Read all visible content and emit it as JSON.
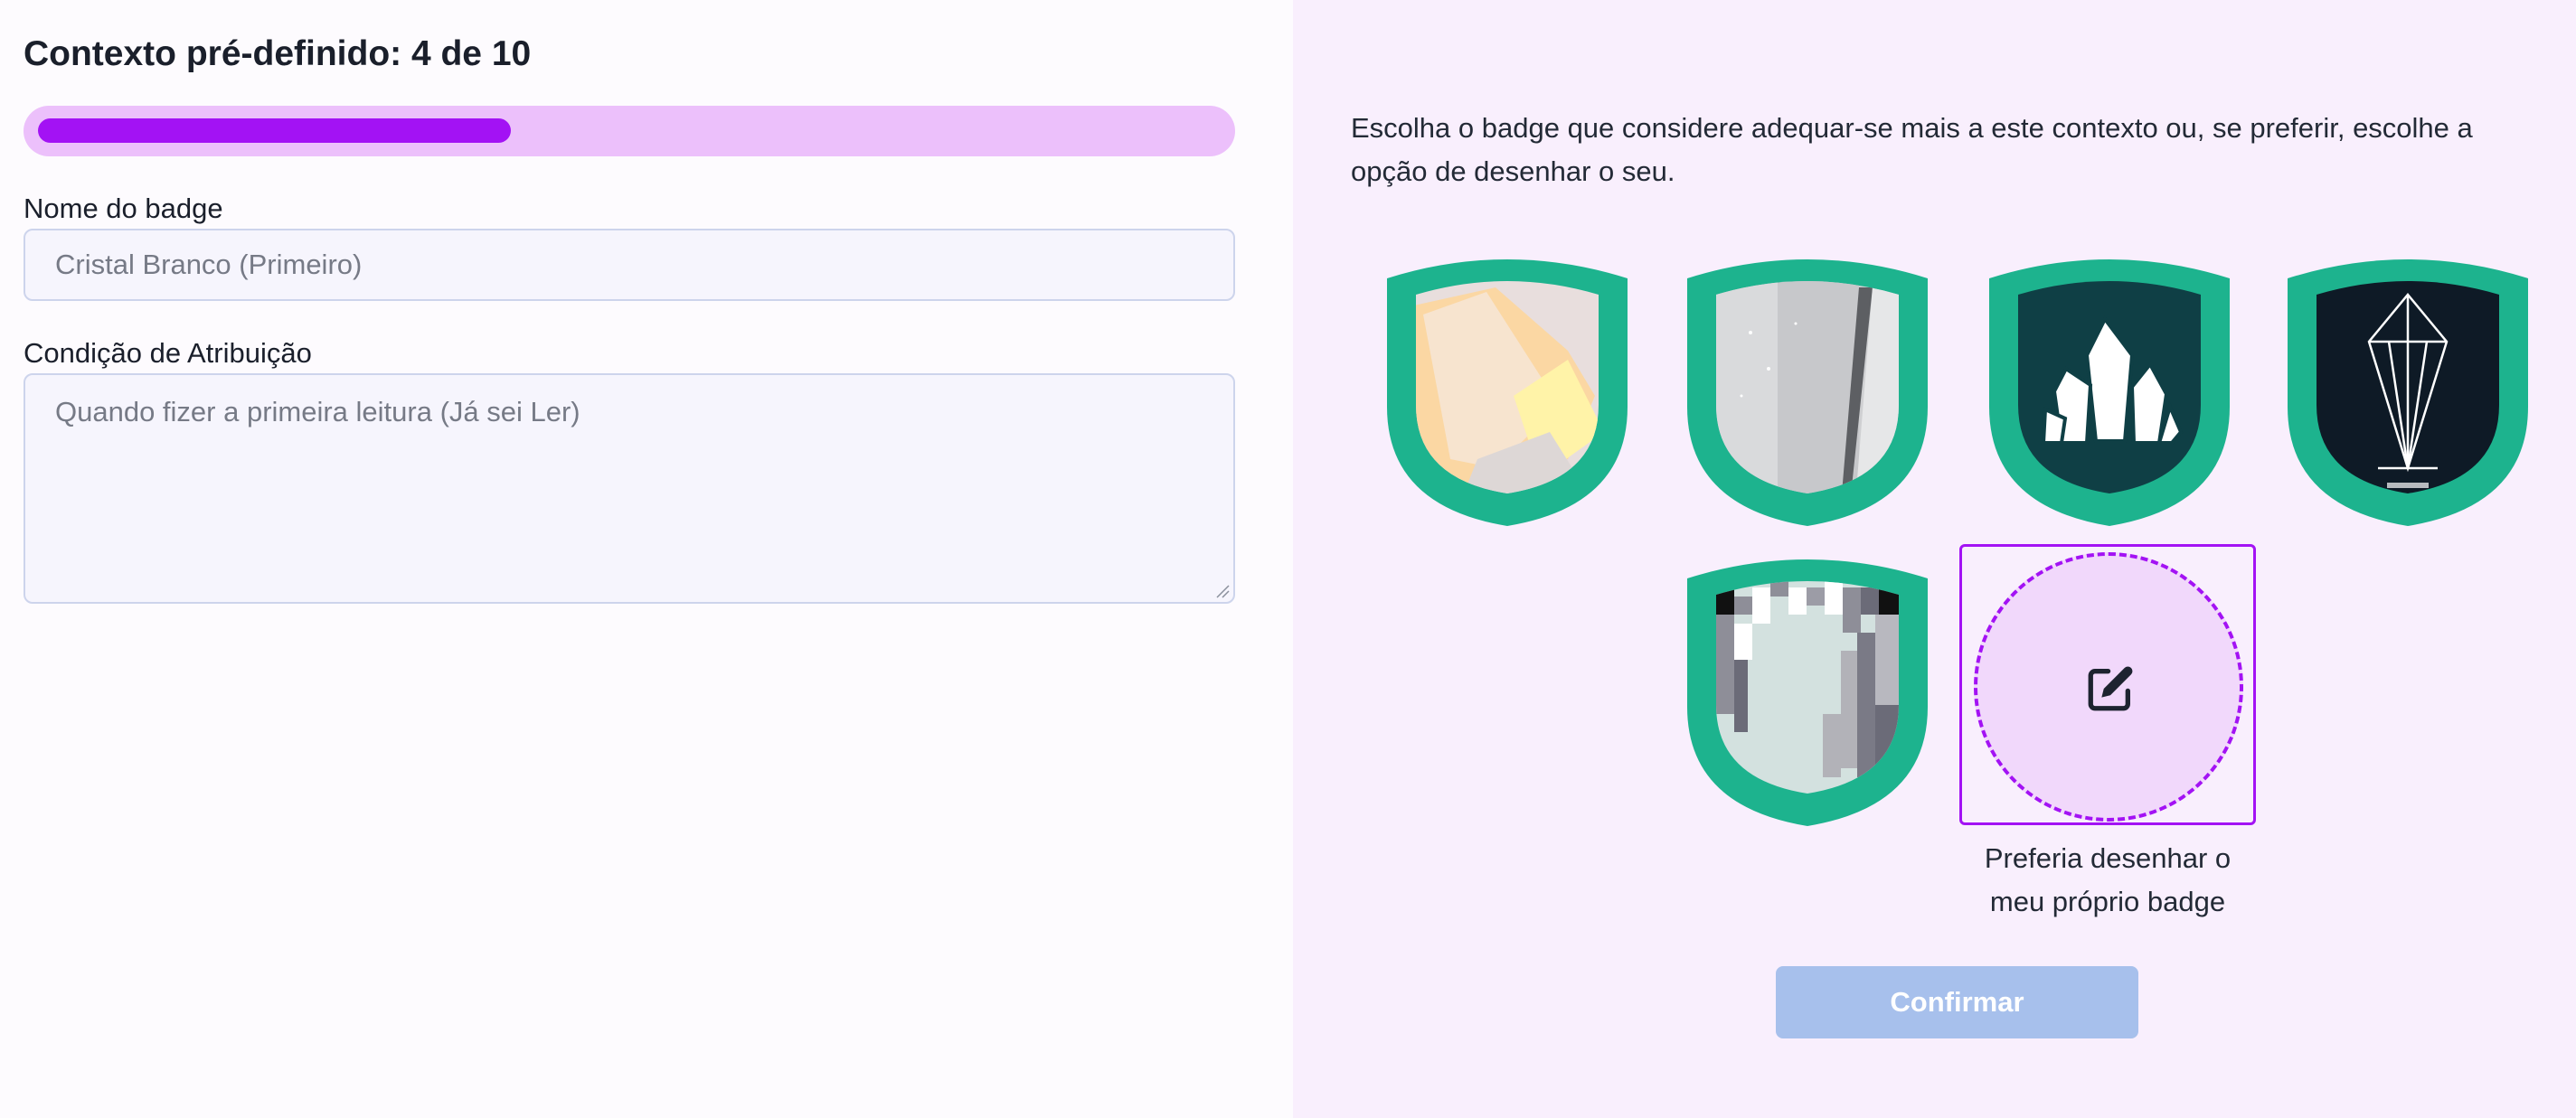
{
  "header": {
    "title": "Contexto pré-definido: 4 de 10",
    "progress_fraction": 0.4
  },
  "form": {
    "name_label": "Nome do badge",
    "name_placeholder": "Cristal Branco (Primeiro)",
    "condition_label": "Condição de Atribuição",
    "condition_placeholder": "Quando fizer a primeira leitura (Já sei Ler)"
  },
  "selection": {
    "intro": "Escolha o badge que considere adequar-se mais a este contexto ou, se preferir, escolhe a opção de desenhar o seu.",
    "badges": [
      {
        "name": "badge-yellow-crystal",
        "image": "yellow crystal photo"
      },
      {
        "name": "badge-grey-crystal",
        "image": "grey crystal texture"
      },
      {
        "name": "badge-white-crystal-cluster",
        "image": "white crystal cluster icon"
      },
      {
        "name": "badge-line-crystal",
        "image": "line-art crystal"
      },
      {
        "name": "badge-pixel-crystal",
        "image": "pixel art crystal"
      }
    ],
    "custom_caption_line1": "Preferia desenhar o",
    "custom_caption_line2": "meu próprio badge",
    "custom_icon": "edit-icon",
    "confirm_label": "Confirmar"
  },
  "colors": {
    "accent": "#a312f4",
    "progress_track": "#ecc0fb",
    "badge_ring": "#1db38e",
    "right_panel": "#f9effd",
    "confirm_disabled": "#a7c0ec"
  }
}
